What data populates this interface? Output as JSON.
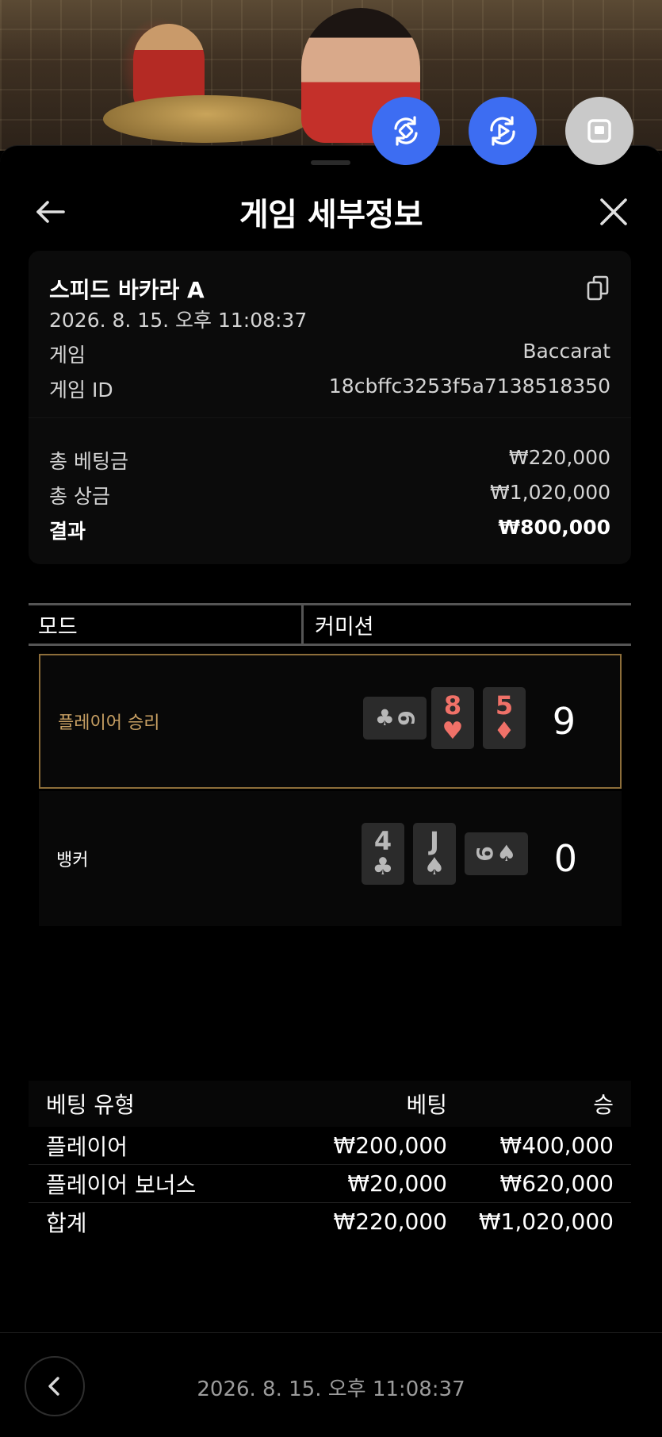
{
  "video_controls": {
    "rotate_icon": "rotate-icon",
    "replay_icon": "replay-icon",
    "stop_icon": "stop-icon"
  },
  "header": {
    "title": "게임 세부정보",
    "back_icon": "arrow-left-icon",
    "close_icon": "close-icon"
  },
  "summary": {
    "game_name": "스피드 바카라 A",
    "datetime": "2026. 8. 15. 오후 11:08:37",
    "copy_icon": "copy-icon",
    "game_label": "게임",
    "game_value": "Baccarat",
    "game_id_label": "게임 ID",
    "game_id_value": "18cbffc3253f5a7138518350",
    "total_bet_label": "총 베팅금",
    "total_bet_value": "₩220,000",
    "total_win_label": "총 상금",
    "total_win_value": "₩1,020,000",
    "result_label": "결과",
    "result_value": "₩800,000"
  },
  "mode": {
    "label": "모드",
    "value": "커미션"
  },
  "hands": {
    "player": {
      "label": "플레이어 승리",
      "score": "9",
      "cards": [
        {
          "rank": "9",
          "suit": "♣",
          "color": "grey"
        },
        {
          "rank": "8",
          "suit": "♥",
          "color": "red"
        },
        {
          "rank": "5",
          "suit": "♦",
          "color": "red"
        }
      ]
    },
    "banker": {
      "label": "뱅커",
      "score": "0",
      "cards": [
        {
          "rank": "4",
          "suit": "♣",
          "color": "grey"
        },
        {
          "rank": "J",
          "suit": "♠",
          "color": "grey"
        },
        {
          "rank": "9",
          "suit": "♠",
          "color": "grey"
        }
      ]
    },
    "accent_color": "#c8a063",
    "red_suit_color": "#f07168"
  },
  "bets": {
    "headers": {
      "type": "베팅 유형",
      "bet": "베팅",
      "win": "승"
    },
    "rows": [
      {
        "type": "플레이어",
        "bet": "₩200,000",
        "win": "₩400,000"
      },
      {
        "type": "플레이어 보너스",
        "bet": "₩20,000",
        "win": "₩620,000"
      }
    ],
    "total": {
      "type": "합계",
      "bet": "₩220,000",
      "win": "₩1,020,000"
    }
  },
  "footer": {
    "back_icon": "chevron-left-icon",
    "datetime": "2026. 8. 15. 오후 11:08:37"
  }
}
